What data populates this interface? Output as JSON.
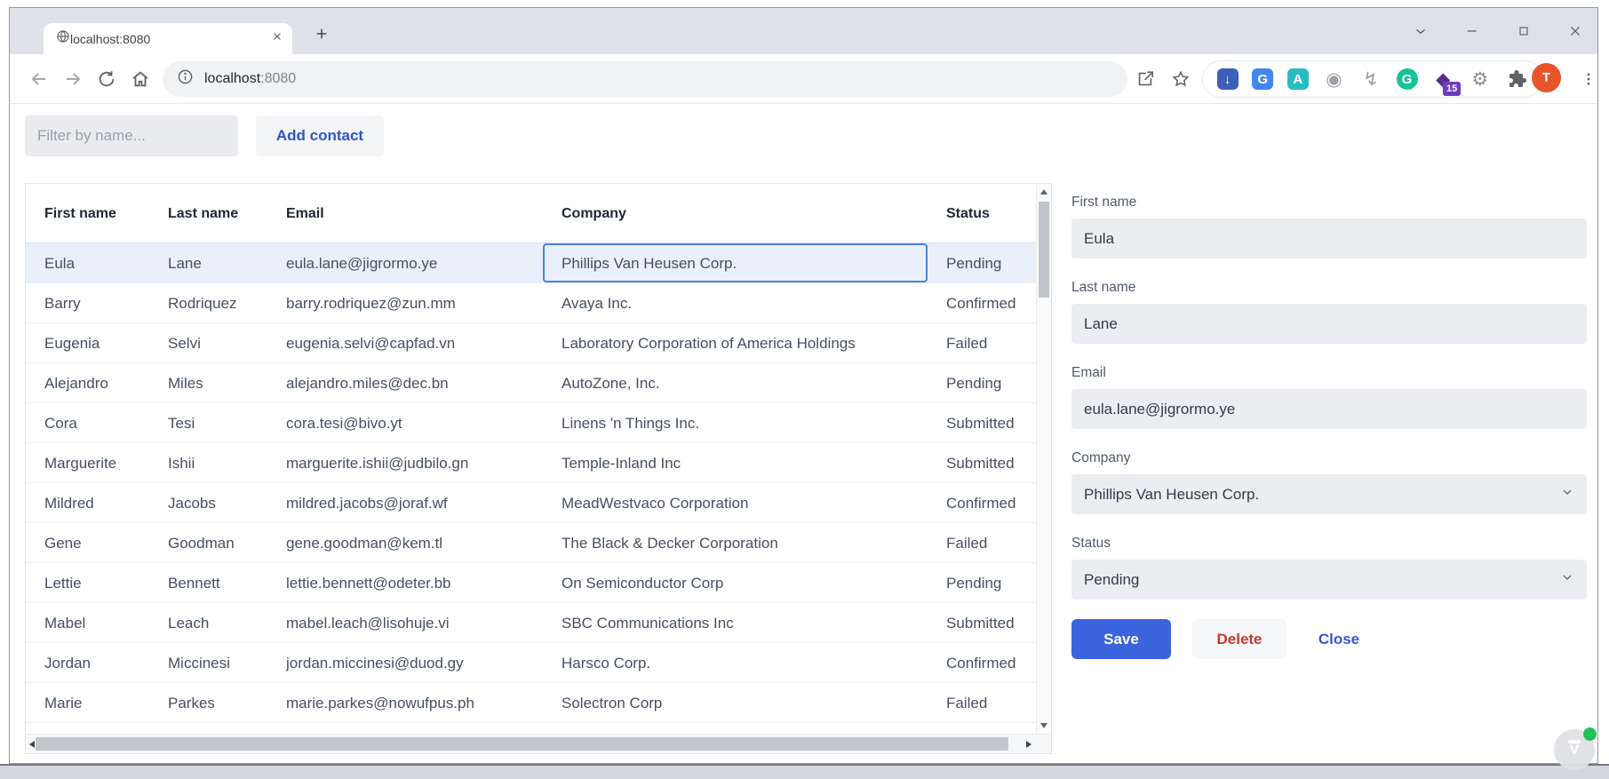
{
  "browser": {
    "tab_title": "localhost:8080",
    "address": {
      "host": "localhost",
      "port": ":8080"
    },
    "profile_initial": "T",
    "extensions": [
      {
        "name": "download-extension-icon",
        "glyph": "↓",
        "shape": "rounded-square",
        "bg": "#3d5fb8",
        "fg": "#ffffff"
      },
      {
        "name": "translate-extension-icon",
        "glyph": "G",
        "shape": "rounded-square",
        "bg": "#4285f4",
        "fg": "#ffffff"
      },
      {
        "name": "input-tools-extension-icon",
        "glyph": "A",
        "shape": "rounded-square",
        "bg": "#27bdc0",
        "fg": "#ffffff"
      },
      {
        "name": "camera-extension-icon",
        "glyph": "◉",
        "shape": "plain",
        "bg": "",
        "fg": "#9aa0a6"
      },
      {
        "name": "lightning-extension-icon",
        "glyph": "↯",
        "shape": "plain",
        "bg": "",
        "fg": "#9aa0a6"
      },
      {
        "name": "grammarly-extension-icon",
        "glyph": "G",
        "shape": "circle",
        "bg": "#15c39a",
        "fg": "#ffffff"
      },
      {
        "name": "scholar-hat-extension-icon",
        "glyph": "◆",
        "shape": "plain",
        "bg": "",
        "fg": "#5b2d90",
        "badge": "15",
        "badge_bg": "#6d3bbf"
      },
      {
        "name": "gear-extension-icon",
        "glyph": "⚙",
        "shape": "plain",
        "bg": "",
        "fg": "#8b9095"
      },
      {
        "name": "puzzle-extension-icon",
        "glyph": "",
        "shape": "puzzle",
        "bg": "",
        "fg": "#5f6368"
      }
    ]
  },
  "toolbar": {
    "filter_placeholder": "Filter by name...",
    "add_contact_label": "Add contact"
  },
  "table": {
    "headers": [
      "First name",
      "Last name",
      "Email",
      "Company",
      "Status"
    ],
    "selected_row_index": 0,
    "focused_cell": {
      "row": 0,
      "column": "Company"
    },
    "rows": [
      {
        "first_name": "Eula",
        "last_name": "Lane",
        "email": "eula.lane@jigrormo.ye",
        "company": "Phillips Van Heusen Corp.",
        "status": "Pending"
      },
      {
        "first_name": "Barry",
        "last_name": "Rodriquez",
        "email": "barry.rodriquez@zun.mm",
        "company": "Avaya Inc.",
        "status": "Confirmed"
      },
      {
        "first_name": "Eugenia",
        "last_name": "Selvi",
        "email": "eugenia.selvi@capfad.vn",
        "company": "Laboratory Corporation of America Holdings",
        "status": "Failed"
      },
      {
        "first_name": "Alejandro",
        "last_name": "Miles",
        "email": "alejandro.miles@dec.bn",
        "company": "AutoZone, Inc.",
        "status": "Pending"
      },
      {
        "first_name": "Cora",
        "last_name": "Tesi",
        "email": "cora.tesi@bivo.yt",
        "company": "Linens 'n Things Inc.",
        "status": "Submitted"
      },
      {
        "first_name": "Marguerite",
        "last_name": "Ishii",
        "email": "marguerite.ishii@judbilo.gn",
        "company": "Temple-Inland Inc",
        "status": "Submitted"
      },
      {
        "first_name": "Mildred",
        "last_name": "Jacobs",
        "email": "mildred.jacobs@joraf.wf",
        "company": "MeadWestvaco Corporation",
        "status": "Confirmed"
      },
      {
        "first_name": "Gene",
        "last_name": "Goodman",
        "email": "gene.goodman@kem.tl",
        "company": "The Black & Decker Corporation",
        "status": "Failed"
      },
      {
        "first_name": "Lettie",
        "last_name": "Bennett",
        "email": "lettie.bennett@odeter.bb",
        "company": "On Semiconductor Corp",
        "status": "Pending"
      },
      {
        "first_name": "Mabel",
        "last_name": "Leach",
        "email": "mabel.leach@lisohuje.vi",
        "company": "SBC Communications Inc",
        "status": "Submitted"
      },
      {
        "first_name": "Jordan",
        "last_name": "Miccinesi",
        "email": "jordan.miccinesi@duod.gy",
        "company": "Harsco Corp.",
        "status": "Confirmed"
      },
      {
        "first_name": "Marie",
        "last_name": "Parkes",
        "email": "marie.parkes@nowufpus.ph",
        "company": "Solectron Corp",
        "status": "Failed"
      }
    ]
  },
  "form": {
    "fields": [
      {
        "label": "First name",
        "value": "Eula",
        "type": "text"
      },
      {
        "label": "Last name",
        "value": "Lane",
        "type": "text"
      },
      {
        "label": "Email",
        "value": "eula.lane@jigrormo.ye",
        "type": "text"
      },
      {
        "label": "Company",
        "value": "Phillips Van Heusen Corp.",
        "type": "select"
      },
      {
        "label": "Status",
        "value": "Pending",
        "type": "select"
      }
    ],
    "buttons": {
      "save": "Save",
      "delete": "Delete",
      "close": "Close"
    }
  },
  "overlay": {
    "badge_initial": "v"
  },
  "colors": {
    "accent_blue": "#3b63dc",
    "link_blue": "#2e54cc",
    "delete_red": "#cd362e",
    "selected_row": "#e9f0fb",
    "focus_ring": "#4a84e2",
    "titlebar": "#dee1e6"
  }
}
